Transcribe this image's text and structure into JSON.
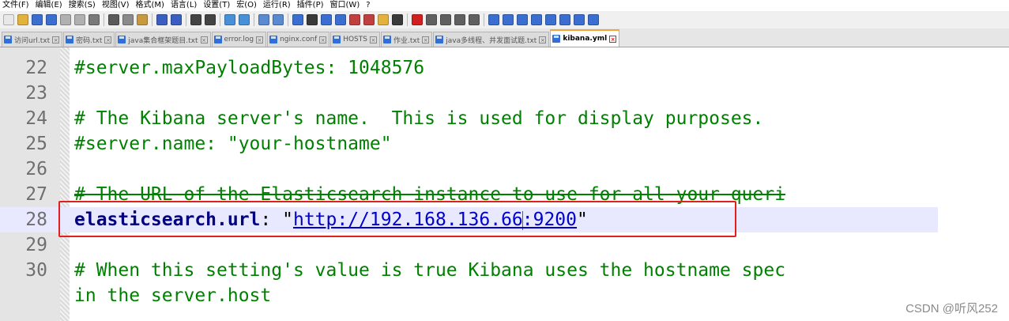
{
  "menu": [
    "文件(F)",
    "编辑(E)",
    "搜索(S)",
    "视图(V)",
    "格式(M)",
    "语言(L)",
    "设置(T)",
    "宏(O)",
    "运行(R)",
    "插件(P)",
    "窗口(W)",
    "?"
  ],
  "toolbar": {
    "buttons": [
      {
        "icon": "new-file-icon",
        "color": "#e8e8e8"
      },
      {
        "icon": "open-file-icon",
        "color": "#e2b23c"
      },
      {
        "icon": "save-icon",
        "color": "#3a6fd0"
      },
      {
        "icon": "save-all-icon",
        "color": "#3a6fd0"
      },
      {
        "icon": "close-icon",
        "color": "#b0b0b0"
      },
      {
        "icon": "close-all-icon",
        "color": "#b0b0b0"
      },
      {
        "icon": "print-icon",
        "color": "#7a7a7a"
      },
      {
        "sep": true
      },
      {
        "icon": "cut-icon",
        "color": "#5a5a5a"
      },
      {
        "icon": "copy-icon",
        "color": "#8a8a8a"
      },
      {
        "icon": "paste-icon",
        "color": "#c89a40"
      },
      {
        "sep": true
      },
      {
        "icon": "undo-icon",
        "color": "#3a5fc0"
      },
      {
        "icon": "redo-icon",
        "color": "#3a5fc0"
      },
      {
        "sep": true
      },
      {
        "icon": "find-icon",
        "color": "#444444"
      },
      {
        "icon": "replace-icon",
        "color": "#444444"
      },
      {
        "sep": true
      },
      {
        "icon": "zoom-in-icon",
        "color": "#4a90d9"
      },
      {
        "icon": "zoom-out-icon",
        "color": "#4a90d9"
      },
      {
        "sep": true
      },
      {
        "icon": "sync-vertical-icon",
        "color": "#5a8ad0"
      },
      {
        "icon": "sync-horizontal-icon",
        "color": "#5a8ad0"
      },
      {
        "sep": true
      },
      {
        "icon": "word-wrap-icon",
        "color": "#3a6fd0"
      },
      {
        "icon": "show-all-chars-icon",
        "color": "#3a3a3a"
      },
      {
        "icon": "indent-guide-icon",
        "color": "#3a6fd0"
      },
      {
        "icon": "udl-icon",
        "color": "#3a6fd0"
      },
      {
        "icon": "doc-map-icon",
        "color": "#c04040"
      },
      {
        "icon": "function-list-icon",
        "color": "#c04040"
      },
      {
        "icon": "folder-workspace-icon",
        "color": "#e2b23c"
      },
      {
        "icon": "monitor-icon",
        "color": "#3a3a3a"
      },
      {
        "sep": true
      },
      {
        "icon": "record-macro-icon",
        "color": "#d02020"
      },
      {
        "icon": "stop-macro-icon",
        "color": "#606060"
      },
      {
        "icon": "play-macro-icon",
        "color": "#606060"
      },
      {
        "icon": "run-macro-icon",
        "color": "#606060"
      },
      {
        "icon": "save-macro-icon",
        "color": "#606060"
      },
      {
        "sep": true
      },
      {
        "icon": "plugin-a-icon",
        "color": "#3a6fd0"
      },
      {
        "icon": "plugin-b-icon",
        "color": "#3a6fd0"
      },
      {
        "icon": "plugin-c-icon",
        "color": "#3a6fd0"
      },
      {
        "icon": "plugin-d-icon",
        "color": "#3a6fd0"
      },
      {
        "icon": "plugin-up-icon",
        "color": "#3a6fd0"
      },
      {
        "icon": "plugin-down-icon",
        "color": "#3a6fd0"
      },
      {
        "icon": "plugin-e-icon",
        "color": "#3a6fd0"
      },
      {
        "icon": "plugin-f-icon",
        "color": "#3a6fd0"
      }
    ]
  },
  "tabs": [
    {
      "label": "访问url.txt",
      "active": false
    },
    {
      "label": "密码.txt",
      "active": false
    },
    {
      "label": "java集合框架题目.txt",
      "active": false
    },
    {
      "label": "error.log",
      "active": false
    },
    {
      "label": "nginx.conf",
      "active": false
    },
    {
      "label": "HOSTS",
      "active": false
    },
    {
      "label": "作业.txt",
      "active": false
    },
    {
      "label": "java多线程、并发面试题.txt",
      "active": false
    },
    {
      "label": "kibana.yml",
      "active": true
    }
  ],
  "editor": {
    "lines": [
      {
        "no": "22",
        "type": "comment",
        "text": "#server.maxPayloadBytes: 1048576"
      },
      {
        "no": "23",
        "type": "blank",
        "text": ""
      },
      {
        "no": "24",
        "type": "comment",
        "text": "# The Kibana server's name.  This is used for display purposes."
      },
      {
        "no": "25",
        "type": "comment",
        "text": "#server.name: \"your-hostname\""
      },
      {
        "no": "26",
        "type": "blank",
        "text": ""
      },
      {
        "no": "27",
        "type": "comment-strike",
        "text": "# The URL of the Elasticsearch instance to use for all your queri"
      },
      {
        "no": "28",
        "type": "setting",
        "key": "elasticsearch.url",
        "sep": ": ",
        "quote": "\"",
        "url_before_caret": "http://192.168.136.66",
        "url_after_caret": ":9200"
      },
      {
        "no": "29",
        "type": "blank",
        "text": ""
      },
      {
        "no": "30",
        "type": "comment",
        "text": "# When this setting's value is true Kibana uses the hostname spec"
      },
      {
        "no": "",
        "type": "comment",
        "text": "in the server.host"
      }
    ]
  },
  "watermark": "CSDN @听风252",
  "colors": {
    "highlight_box": "#e02020",
    "current_line": "#e8e8ff",
    "comment": "#008000",
    "key": "#000080",
    "url": "#0000cc"
  }
}
